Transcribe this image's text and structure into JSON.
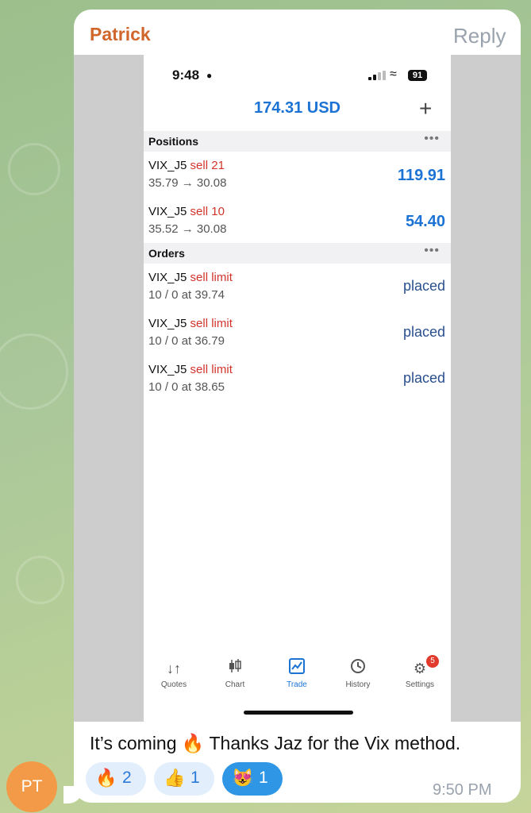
{
  "message": {
    "sender": "Patrick",
    "reply_label": "Reply",
    "text": "It’s coming 🔥  Thanks Jaz for the Vix method.",
    "time": "9:50 PM",
    "avatar_initials": "PT",
    "reactions": [
      {
        "emoji": "🔥",
        "count": "2"
      },
      {
        "emoji": "👍",
        "count": "1"
      },
      {
        "emoji": "😻",
        "count": "1",
        "selected": true
      }
    ]
  },
  "phone": {
    "status_time": "9:48",
    "battery": "91",
    "balance": "174.31 USD",
    "positions_label": "Positions",
    "positions": [
      {
        "symbol": "VIX_J5",
        "action": "sell 21",
        "prices": "35.79 → 30.08",
        "value": "119.91"
      },
      {
        "symbol": "VIX_J5",
        "action": "sell 10",
        "prices": "35.52 → 30.08",
        "value": "54.40"
      }
    ],
    "orders_label": "Orders",
    "orders": [
      {
        "symbol": "VIX_J5",
        "action": "sell limit",
        "detail": "10 / 0 at 39.74",
        "status": "placed"
      },
      {
        "symbol": "VIX_J5",
        "action": "sell limit",
        "detail": "10 / 0 at 36.79",
        "status": "placed"
      },
      {
        "symbol": "VIX_J5",
        "action": "sell limit",
        "detail": "10 / 0 at 38.65",
        "status": "placed"
      }
    ],
    "tabs": [
      {
        "label": "Quotes",
        "icon": "quotes-icon"
      },
      {
        "label": "Chart",
        "icon": "candlestick-icon"
      },
      {
        "label": "Trade",
        "icon": "trade-chart-icon",
        "active": true
      },
      {
        "label": "History",
        "icon": "history-icon"
      },
      {
        "label": "Settings",
        "icon": "gear-icon",
        "badge": "5"
      }
    ]
  }
}
